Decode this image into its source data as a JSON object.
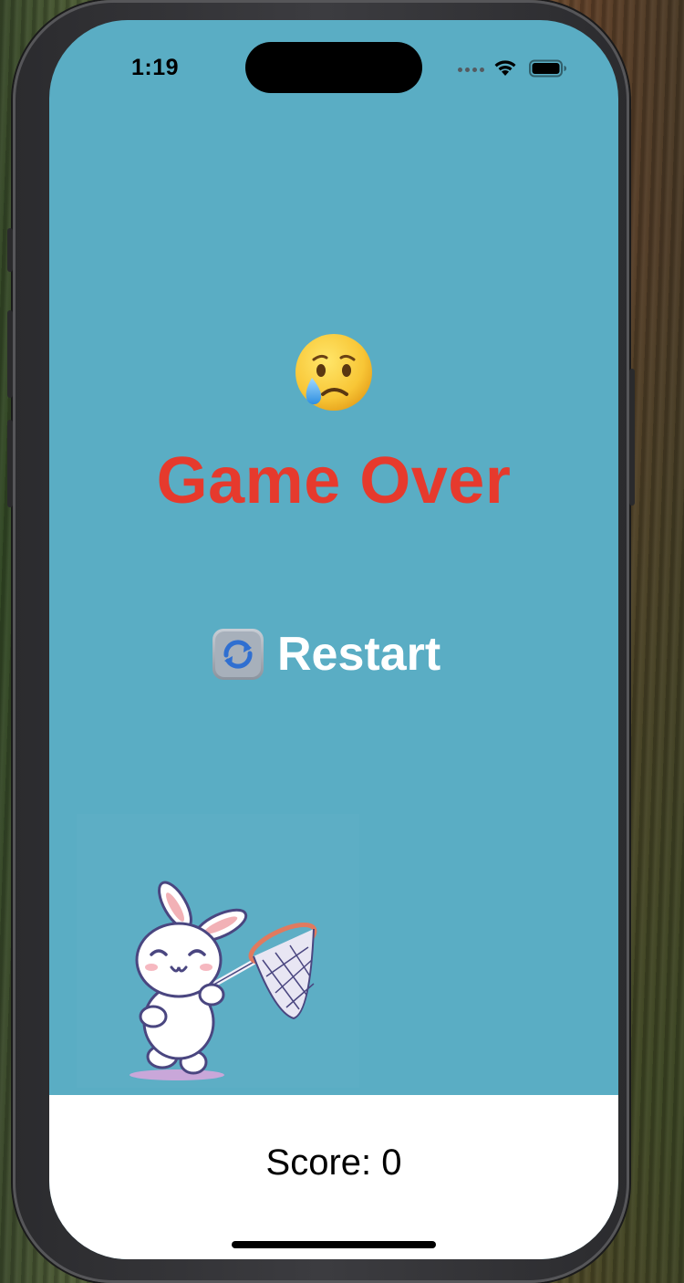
{
  "status_bar": {
    "time": "1:19",
    "icons": [
      "signal-dots-icon",
      "wifi-icon",
      "battery-icon"
    ]
  },
  "game": {
    "emoji_icon": "crying-face-icon",
    "title": "Game Over",
    "title_color": "#e63a2d",
    "background_color": "#5aadc4",
    "restart": {
      "icon": "repeat-arrows-icon",
      "label": "Restart"
    },
    "character": "bunny-with-net-illustration"
  },
  "footer": {
    "score_text": "Score: 0"
  }
}
